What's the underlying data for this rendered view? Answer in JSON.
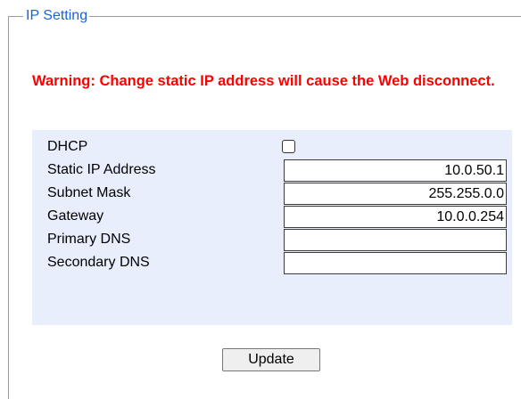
{
  "section": {
    "legend": "IP Setting"
  },
  "warning": {
    "text": "Warning: Change static IP address will cause the Web disconnect."
  },
  "fields": {
    "dhcp": {
      "label": "DHCP",
      "checked": false
    },
    "static_ip": {
      "label": "Static IP Address",
      "value": "10.0.50.1"
    },
    "subnet_mask": {
      "label": "Subnet Mask",
      "value": "255.255.0.0"
    },
    "gateway": {
      "label": "Gateway",
      "value": "10.0.0.254"
    },
    "primary_dns": {
      "label": "Primary DNS",
      "value": ""
    },
    "secondary_dns": {
      "label": "Secondary DNS",
      "value": ""
    }
  },
  "actions": {
    "update_label": "Update"
  },
  "colors": {
    "legend": "#1a62d6",
    "warning": "#ff0000",
    "table_background": "#e8eefc"
  }
}
